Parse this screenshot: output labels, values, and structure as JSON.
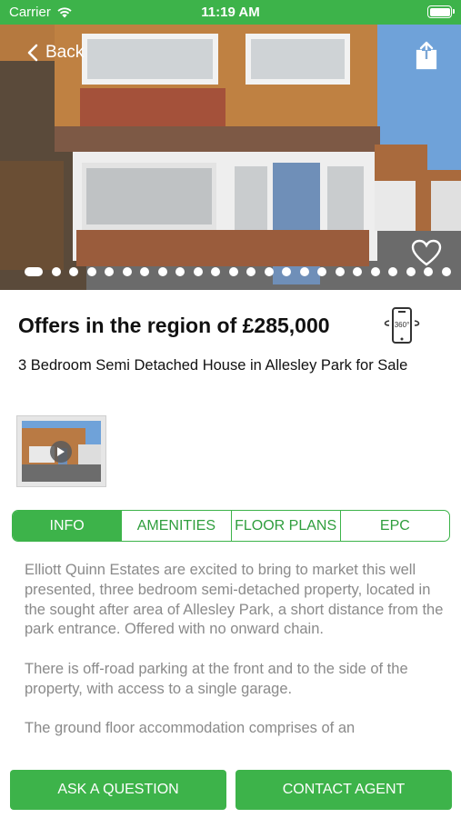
{
  "status_bar": {
    "carrier": "Carrier",
    "time": "11:19 AM"
  },
  "nav": {
    "back_label": "Back"
  },
  "gallery": {
    "total_images": 24,
    "current_index": 1
  },
  "listing": {
    "price": "Offers in the region of £285,000",
    "title": "3 Bedroom Semi Detached House in Allesley Park for Sale"
  },
  "tabs": [
    {
      "label": "INFO",
      "active": true
    },
    {
      "label": "AMENITIES",
      "active": false
    },
    {
      "label": "FLOOR PLANS",
      "active": false
    },
    {
      "label": "EPC",
      "active": false
    }
  ],
  "description": [
    "Elliott Quinn Estates are excited to bring to market this well presented, three bedroom semi-detached property, located in the sought after area of Allesley Park, a short distance from the park entrance. Offered with no onward chain.",
    "There is off-road parking at the front and to the side of the property, with access to a single garage.",
    "The ground floor accommodation comprises of an"
  ],
  "actions": {
    "ask_label": "ASK A QUESTION",
    "contact_label": "CONTACT AGENT"
  },
  "colors": {
    "brand_green": "#3db34a",
    "description_text": "#8a8a8a"
  },
  "icons": [
    "wifi-icon",
    "battery-icon",
    "chevron-left-icon",
    "share-icon",
    "heart-icon",
    "vr-360-icon",
    "play-icon"
  ],
  "vr_badge": "360°"
}
